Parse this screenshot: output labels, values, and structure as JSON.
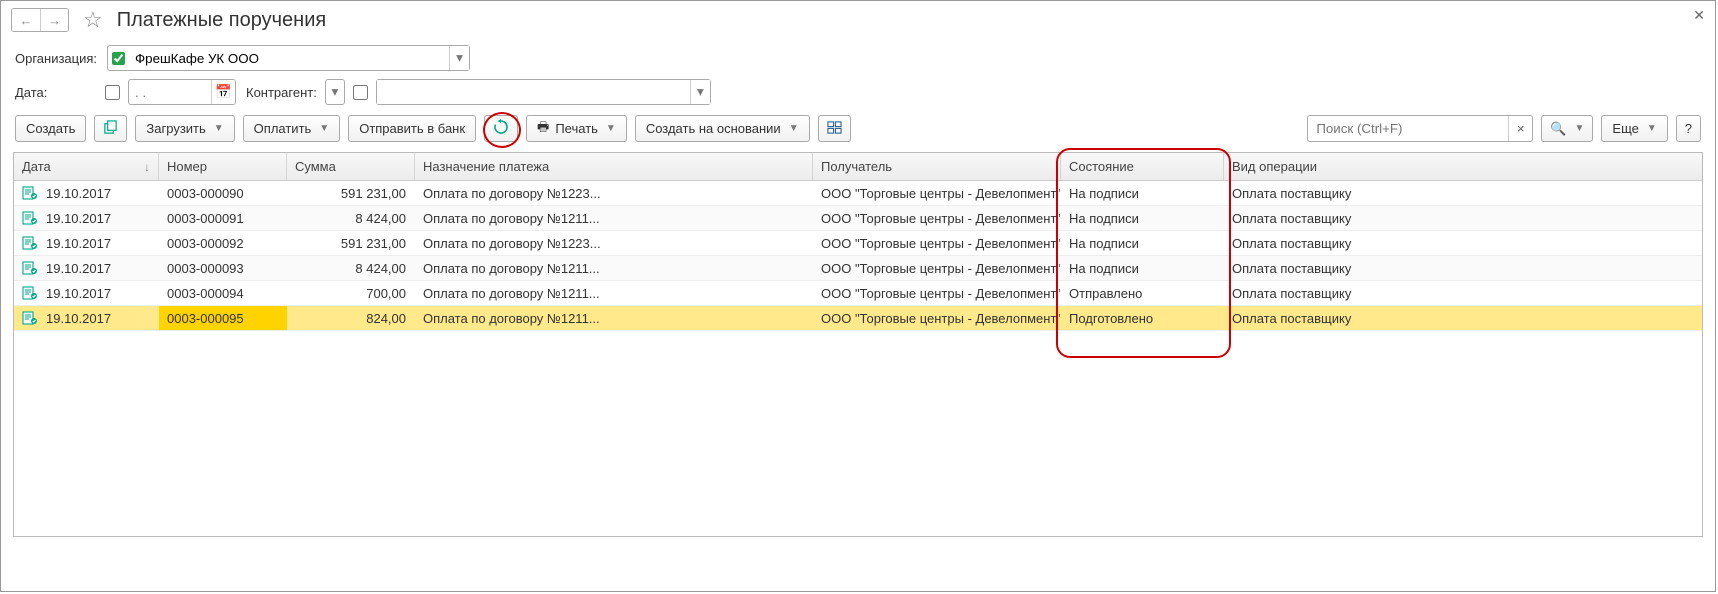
{
  "header": {
    "title": "Платежные поручения"
  },
  "filters": {
    "org_label": "Организация:",
    "org_value": "ФрешКафе УК ООО",
    "date_label": "Дата:",
    "date_placeholder": ". .",
    "ctr_label": "Контрагент:"
  },
  "toolbar": {
    "create": "Создать",
    "load": "Загрузить",
    "pay": "Оплатить",
    "send": "Отправить в банк",
    "print": "Печать",
    "create_on": "Создать на основании",
    "more": "Еще"
  },
  "search": {
    "placeholder": "Поиск (Ctrl+F)"
  },
  "columns": {
    "date": "Дата",
    "num": "Номер",
    "sum": "Сумма",
    "purpose": "Назначение платежа",
    "recipient": "Получатель",
    "state": "Состояние",
    "op": "Вид операции"
  },
  "rows": [
    {
      "date": "19.10.2017",
      "num": "0003-000090",
      "sum": "591 231,00",
      "purpose": "Оплата по договору №1223...",
      "recipient": "ООО \"Торговые центры - Девелопмент\"",
      "state": "На подписи",
      "op": "Оплата поставщику",
      "selected": false
    },
    {
      "date": "19.10.2017",
      "num": "0003-000091",
      "sum": "8 424,00",
      "purpose": "Оплата по договору №1211...",
      "recipient": "ООО \"Торговые центры - Девелопмент\"",
      "state": "На подписи",
      "op": "Оплата поставщику",
      "selected": false
    },
    {
      "date": "19.10.2017",
      "num": "0003-000092",
      "sum": "591 231,00",
      "purpose": "Оплата по договору №1223...",
      "recipient": "ООО \"Торговые центры - Девелопмент\"",
      "state": "На подписи",
      "op": "Оплата поставщику",
      "selected": false
    },
    {
      "date": "19.10.2017",
      "num": "0003-000093",
      "sum": "8 424,00",
      "purpose": "Оплата по договору №1211...",
      "recipient": "ООО \"Торговые центры - Девелопмент\"",
      "state": "На подписи",
      "op": "Оплата поставщику",
      "selected": false
    },
    {
      "date": "19.10.2017",
      "num": "0003-000094",
      "sum": "700,00",
      "purpose": "Оплата по договору №1211...",
      "recipient": "ООО \"Торговые центры - Девелопмент\"",
      "state": "Отправлено",
      "op": "Оплата поставщику",
      "selected": false
    },
    {
      "date": "19.10.2017",
      "num": "0003-000095",
      "sum": "824,00",
      "purpose": "Оплата по договору №1211...",
      "recipient": "ООО \"Торговые центры - Девелопмент\"",
      "state": "Подготовлено",
      "op": "Оплата поставщику",
      "selected": true
    }
  ]
}
